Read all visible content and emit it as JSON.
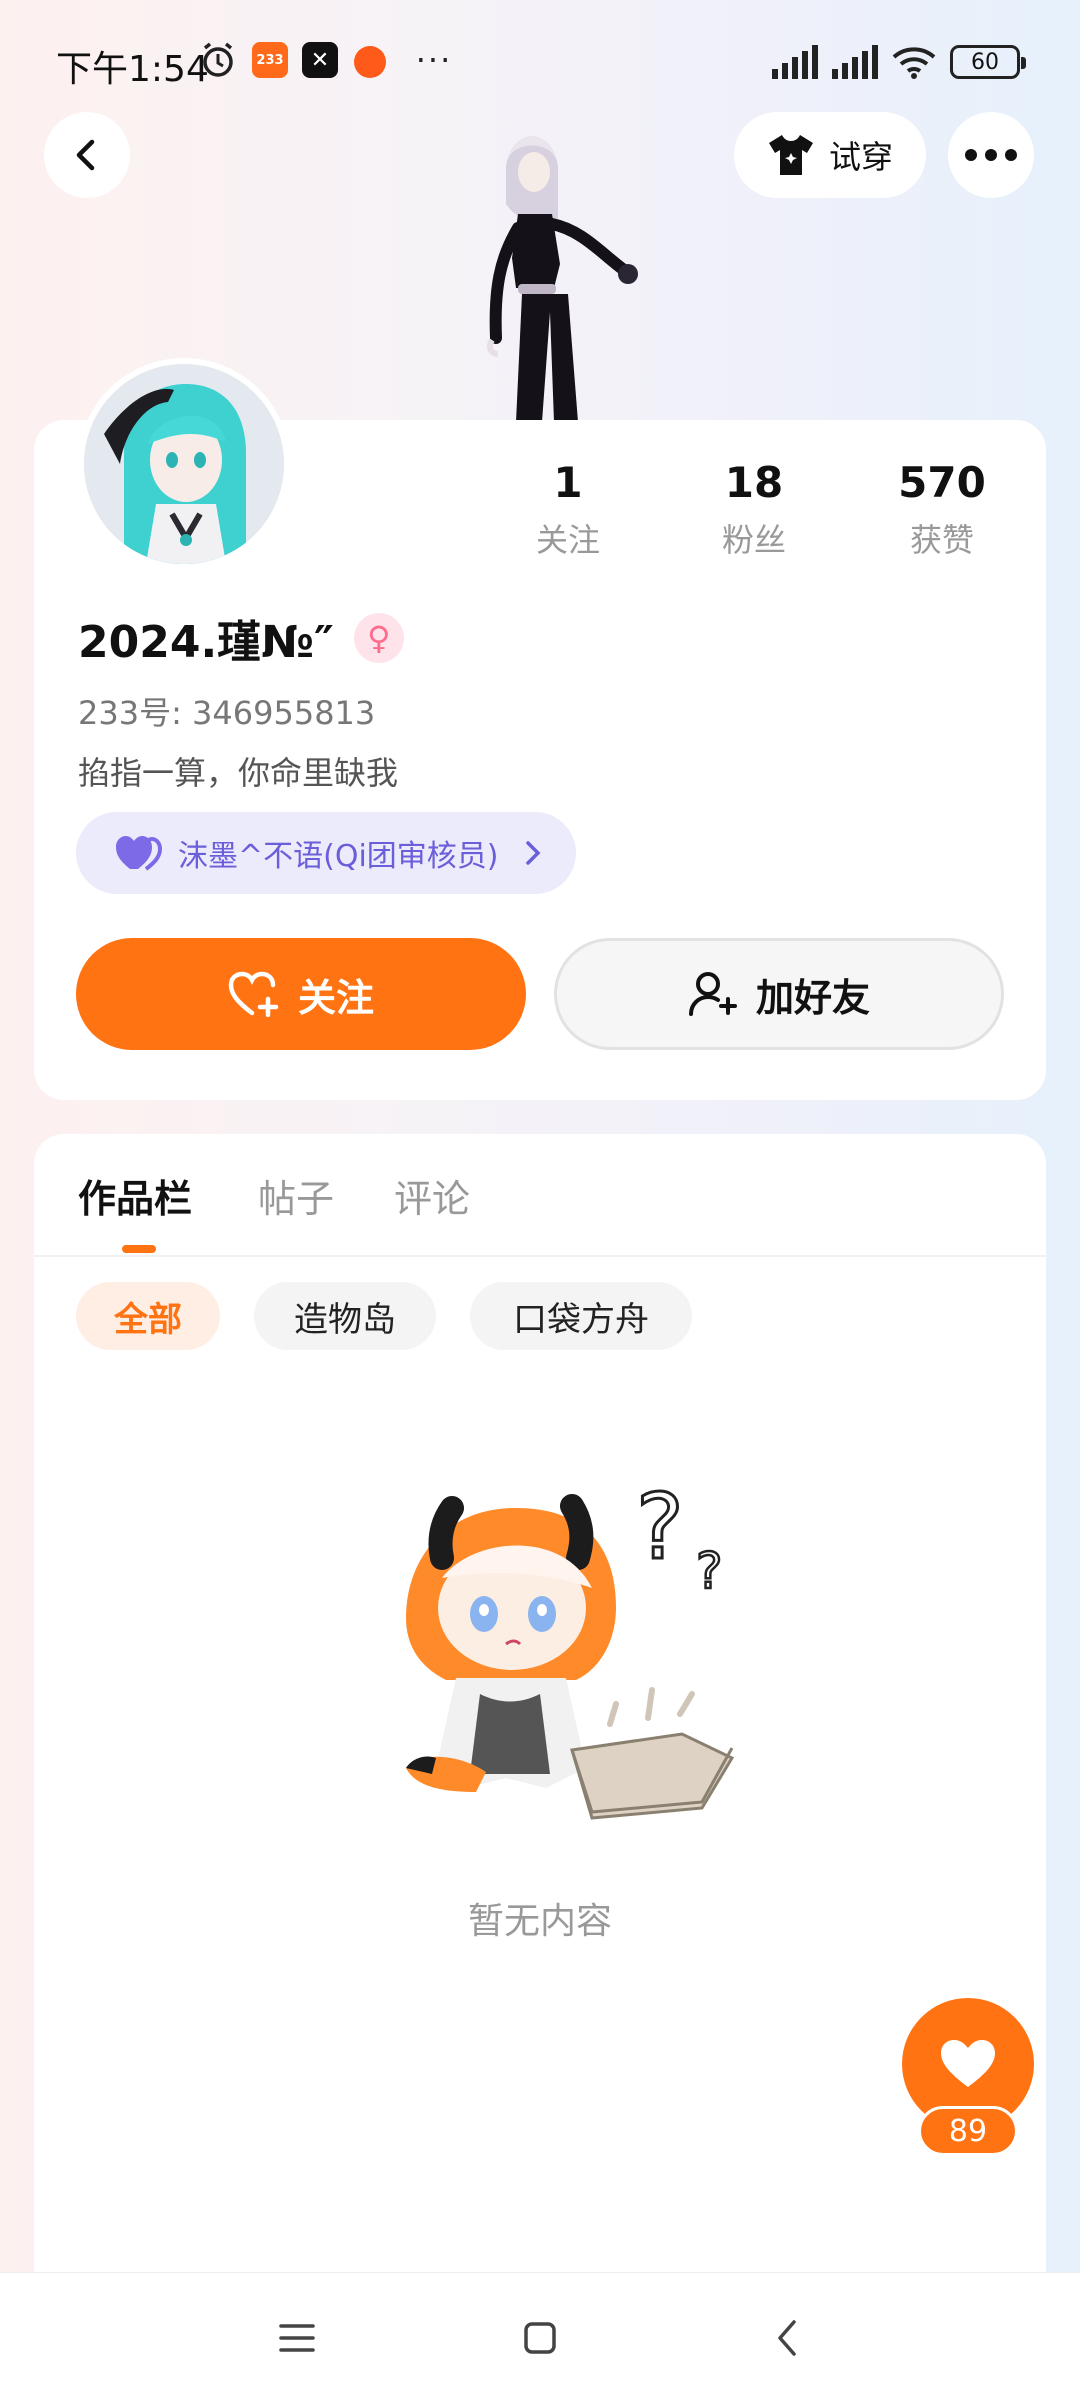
{
  "status_bar": {
    "time": "下午1:54",
    "app_badge": "233",
    "battery": "60",
    "more": "···"
  },
  "top_bar": {
    "tryon_label": "试穿"
  },
  "profile": {
    "stats": [
      {
        "value": "1",
        "label": "关注"
      },
      {
        "value": "18",
        "label": "粉丝"
      },
      {
        "value": "570",
        "label": "获赞"
      }
    ],
    "username": "2024.瑾№″",
    "gender_symbol": "♀",
    "uid": "233号: 346955813",
    "bio": "掐指一算，你命里缺我",
    "group_tag": "沫墨^不语(Qi团审核员)",
    "follow_label": "关注",
    "add_friend_label": "加好友"
  },
  "content": {
    "tabs": [
      "作品栏",
      "帖子",
      "评论"
    ],
    "chips": [
      "全部",
      "造物岛",
      "口袋方舟"
    ],
    "empty_text": "暂无内容"
  },
  "like": {
    "count": "89"
  },
  "colors": {
    "accent": "#ff7312",
    "tag_bg": "#ecebfc",
    "tag_text": "#6b5ed9"
  }
}
